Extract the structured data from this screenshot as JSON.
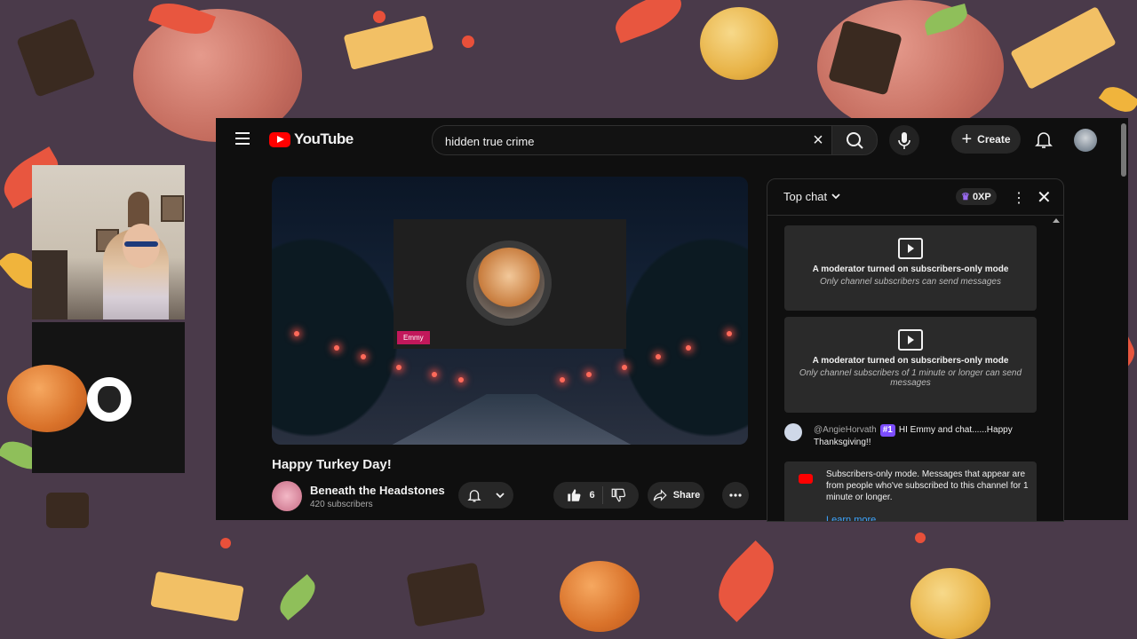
{
  "app": {
    "brand": "YouTube"
  },
  "search": {
    "value": "hidden true crime",
    "clear_icon": "×"
  },
  "header": {
    "create_label": "Create"
  },
  "video": {
    "title": "Happy Turkey Day!",
    "participant_name": "Emmy",
    "channel_name": "Beneath the Headstones",
    "subscribers": "420 subscribers",
    "like_count": "6",
    "share_label": "Share"
  },
  "chat": {
    "mode_label": "Top chat",
    "xp_label": "0XP",
    "cards": [
      {
        "heading": "A moderator turned on subscribers-only mode",
        "sub": "Only channel subscribers can send messages"
      },
      {
        "heading": "A moderator turned on subscribers-only mode",
        "sub": "Only channel subscribers of 1 minute or longer can send messages"
      }
    ],
    "message": {
      "user": "@AngieHorvath",
      "badge": "#1",
      "text": "HI Emmy and chat......Happy Thanksgiving!!"
    },
    "notice": {
      "text": "Subscribers-only mode. Messages that appear are from people who've subscribed to this channel for 1 minute or longer.",
      "link": "Learn more"
    }
  },
  "colors": {
    "brand_red": "#ff0000",
    "accent_link": "#3ea6ff",
    "name_tag": "#c2185b",
    "badge": "#7c4dff"
  }
}
